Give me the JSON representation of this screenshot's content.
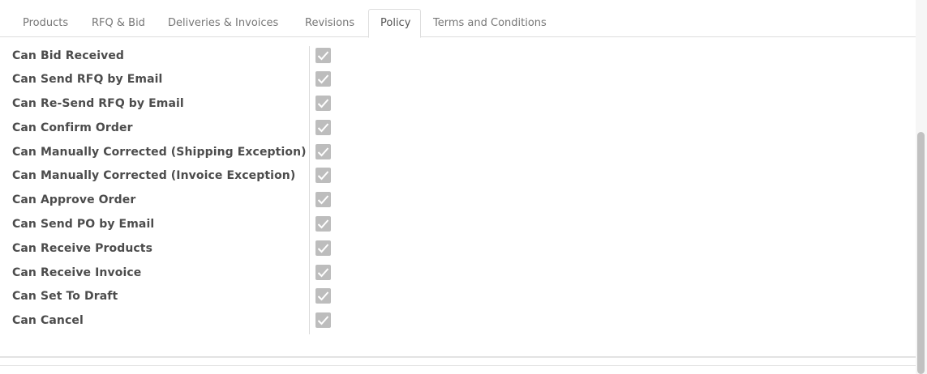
{
  "tabs": [
    {
      "label": "Products",
      "active": false
    },
    {
      "label": "RFQ & Bid",
      "active": false
    },
    {
      "label": "Deliveries & Invoices",
      "active": false
    },
    {
      "label": "Revisions",
      "active": false
    },
    {
      "label": "Policy",
      "active": true
    },
    {
      "label": "Terms and Conditions",
      "active": false
    }
  ],
  "policy": {
    "rows": [
      {
        "label": "Can Bid Received",
        "checked": true
      },
      {
        "label": "Can Send RFQ by Email",
        "checked": true
      },
      {
        "label": "Can Re-Send RFQ by Email",
        "checked": true
      },
      {
        "label": "Can Confirm Order",
        "checked": true
      },
      {
        "label": "Can Manually Corrected (Shipping Exception)",
        "checked": true
      },
      {
        "label": "Can Manually Corrected (Invoice Exception)",
        "checked": true
      },
      {
        "label": "Can Approve Order",
        "checked": true
      },
      {
        "label": "Can Send PO by Email",
        "checked": true
      },
      {
        "label": "Can Receive Products",
        "checked": true
      },
      {
        "label": "Can Receive Invoice",
        "checked": true
      },
      {
        "label": "Can Set To Draft",
        "checked": true
      },
      {
        "label": "Can Cancel",
        "checked": true
      }
    ]
  },
  "colors": {
    "checkbox_disabled": "#bdbdbd",
    "label_text": "#4c4c4c",
    "tab_text": "#777777"
  }
}
